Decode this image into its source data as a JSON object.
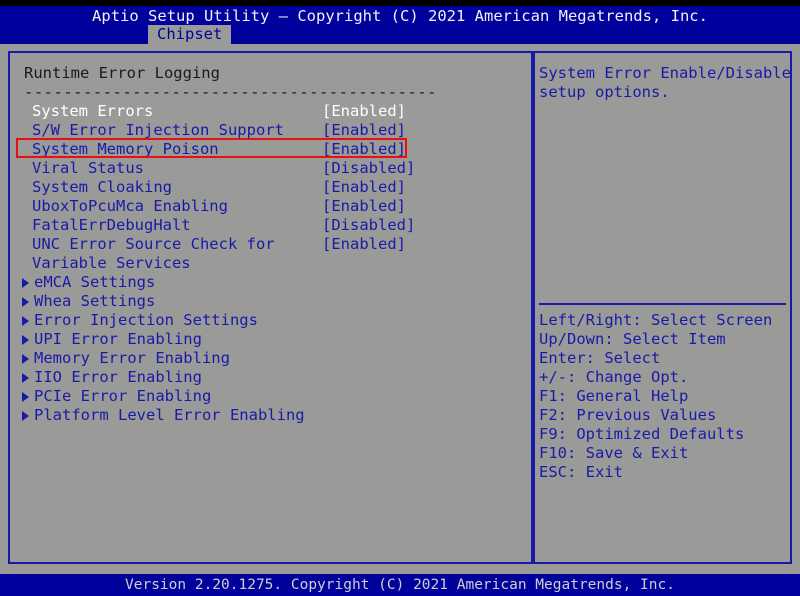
{
  "header": {
    "title": "Aptio Setup Utility – Copyright (C) 2021 American Megatrends, Inc.",
    "active_tab": "Chipset"
  },
  "colors": {
    "header_bg": "#00009c",
    "screen_bg": "#9a9a98",
    "accent_blue": "#1a1aa8",
    "selected_text": "#ffffff",
    "highlight_box": "#e81010",
    "footer_text": "#cfcfcf"
  },
  "main": {
    "section_title": "Runtime Error Logging",
    "section_rule": "------------------------------------------",
    "options": [
      {
        "label": "System Errors",
        "value": "[Enabled]",
        "selected": true,
        "boxed": false
      },
      {
        "label": "S/W Error Injection Support",
        "value": "[Enabled]",
        "selected": false,
        "boxed": false
      },
      {
        "label": "System Memory Poison",
        "value": "[Enabled]",
        "selected": false,
        "boxed": true
      },
      {
        "label": "Viral Status",
        "value": "[Disabled]",
        "selected": false,
        "boxed": false
      },
      {
        "label": "System Cloaking",
        "value": "[Enabled]",
        "selected": false,
        "boxed": false
      },
      {
        "label": "UboxToPcuMca Enabling",
        "value": "[Enabled]",
        "selected": false,
        "boxed": false
      },
      {
        "label": "FatalErrDebugHalt",
        "value": "[Disabled]",
        "selected": false,
        "boxed": false
      },
      {
        "label": "UNC Error Source Check for",
        "value": "[Enabled]",
        "selected": false,
        "boxed": false
      },
      {
        "label": "Variable Services",
        "value": "",
        "selected": false,
        "boxed": false
      }
    ],
    "submenus": [
      {
        "label": "eMCA Settings",
        "icon": "triangle-right-icon"
      },
      {
        "label": "Whea Settings",
        "icon": "triangle-right-icon"
      },
      {
        "label": "Error Injection Settings",
        "icon": "triangle-right-icon"
      },
      {
        "label": "UPI Error Enabling",
        "icon": "triangle-right-icon"
      },
      {
        "label": "Memory Error Enabling",
        "icon": "triangle-right-icon"
      },
      {
        "label": "IIO Error Enabling",
        "icon": "triangle-right-icon"
      },
      {
        "label": "PCIe Error Enabling",
        "icon": "triangle-right-icon"
      },
      {
        "label": "Platform Level Error Enabling",
        "icon": "triangle-right-icon"
      }
    ]
  },
  "help": {
    "lines": [
      "System Error Enable/Disable",
      "setup options."
    ],
    "keys": [
      "Left/Right: Select Screen",
      "Up/Down: Select Item",
      "Enter: Select",
      "+/-: Change Opt.",
      "F1: General Help",
      "F2: Previous Values",
      "F9: Optimized Defaults",
      "F10: Save & Exit",
      "ESC: Exit"
    ]
  },
  "footer": {
    "text": "Version 2.20.1275. Copyright (C) 2021 American Megatrends, Inc."
  }
}
